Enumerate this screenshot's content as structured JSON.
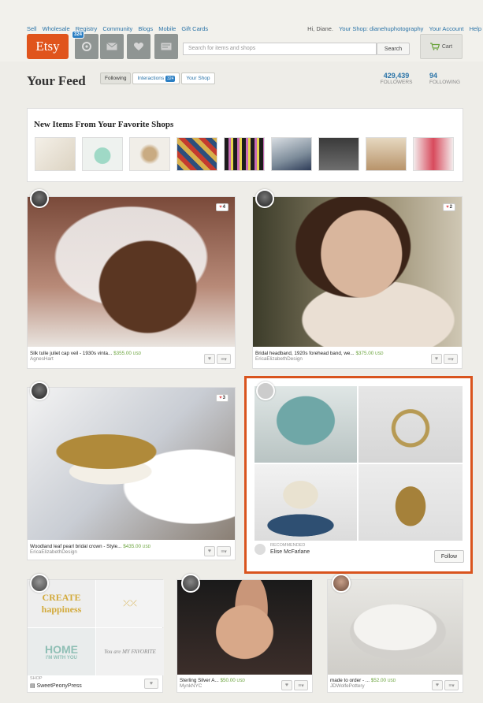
{
  "topnav": {
    "links": [
      "Sell",
      "Wholesale",
      "Registry",
      "Community",
      "Blogs",
      "Mobile",
      "Gift Cards"
    ],
    "greeting": "Hi, Diane.",
    "shop_link": "Your Shop: dianehuphotography",
    "account_link": "Your Account",
    "help_link": "Help",
    "logo": "Etsy",
    "activity_badge": "324",
    "search_placeholder": "Search for items and shops",
    "search_button": "Search",
    "cart": "Cart"
  },
  "feed": {
    "title": "Your Feed",
    "tabs": [
      {
        "label": "Following"
      },
      {
        "label": "Interactions",
        "count": "324"
      },
      {
        "label": "Your Shop"
      }
    ],
    "followers_count": "429,439",
    "followers_label": "FOLLOWERS",
    "following_count": "94",
    "following_label": "FOLLOWING"
  },
  "favorites": {
    "title": "New Items From Your Favorite Shops"
  },
  "cards": [
    {
      "title": "Silk tulle juliet cap veil - 1930s vinta...",
      "price": "$355.00",
      "currency": "USD",
      "shop": "AgnesHart",
      "hearts": "4"
    },
    {
      "title": "Bridal headband, 1920s forehead band, we...",
      "price": "$375.00",
      "currency": "USD",
      "shop": "EricaElizabethDesign",
      "hearts": "2"
    },
    {
      "title": "Woodland leaf pearl bridal crown - Style...",
      "price": "$435.00",
      "currency": "USD",
      "shop": "EricaElizabethDesign",
      "hearts": "3"
    },
    {
      "title": "Sterling Silver A...",
      "price": "$50.00",
      "currency": "USD",
      "shop": "MynkNYC"
    },
    {
      "title": "made to order - ...",
      "price": "$52.00",
      "currency": "USD",
      "shop": "JDWolfePottery"
    }
  ],
  "recommended": {
    "label": "RECOMMENDED",
    "name": "Elise McFarlane",
    "button": "Follow"
  },
  "shop_card": {
    "label": "SHOP",
    "name": "SweetPeonyPress",
    "prints": [
      "CREATE happiness",
      "HOME",
      "I'M WITH YOU",
      "You are MY FAVORITE"
    ]
  }
}
